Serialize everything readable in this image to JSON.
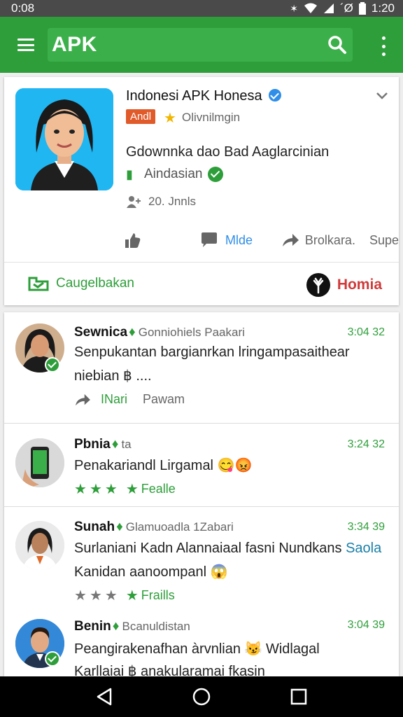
{
  "status_bar": {
    "time": "0:08",
    "right_text": "´Ø",
    "battery_time": "1:20"
  },
  "app_bar": {
    "search_text": "APK"
  },
  "top_card": {
    "title": "Indonesi APK Honesa",
    "tag": "Andl",
    "rating_label": "Olivnilmgin",
    "description": "Gdownnka dao Bad Aaglarcinian",
    "developer": "Aindasian",
    "downloads": "20. Jnnls",
    "actions": {
      "comment_label": "Mlde",
      "share_label": "Brolkara.",
      "extra_label": "Supe"
    },
    "bottom_left_label": "Caugelbakan",
    "bottom_right_label": "Homia"
  },
  "posts": [
    {
      "name": "Sewnica",
      "meta": "Gonniohiels Paakari",
      "time": "3:04 32",
      "line1": "Senpukantan bargianrkan lringampasaithear",
      "line2": "niebian ฿ ....",
      "action1": "INari",
      "action2": "Pawam"
    },
    {
      "name": "Pbnia",
      "meta": "ta",
      "time": "3:24 32",
      "line1": "Penakariandl Lirgamal 😋😡",
      "stars_label": "Fealle"
    },
    {
      "name": "Sunah",
      "meta": "Glamuoadla 1Zabari",
      "time": "3:34 39",
      "line1": "Surlaniani Kadn Alannaiaal fasni Nundkans",
      "line1_link": "Saola",
      "line2": "Kanidan aanoompanl 😱",
      "stars_label": "Fraills"
    },
    {
      "name": "Benin",
      "meta": "Bcanuldistan",
      "time": "3:04 39",
      "line1": "Peangirakenafhan àrvnlian 😼 Widlagal",
      "line2": "Karllaiai ฿ anakularamai fkasin"
    }
  ],
  "colors": {
    "primary_green": "#2e9e3a",
    "search_green": "#3bb04a",
    "link_blue": "#2f8ee8",
    "tag_orange": "#e05a2a",
    "accent_red": "#d03a3a"
  }
}
